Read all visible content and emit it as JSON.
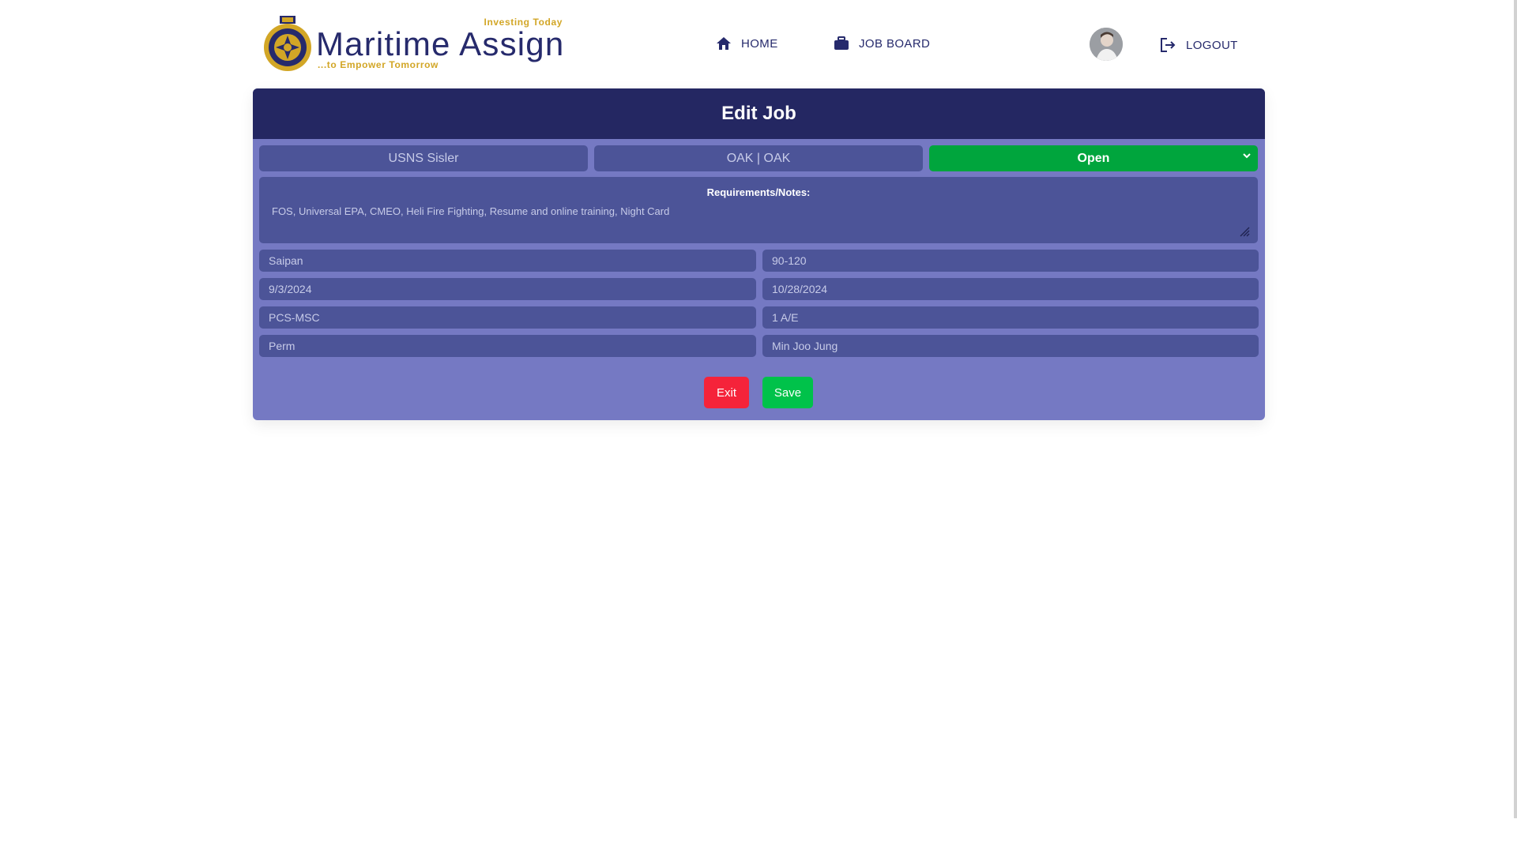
{
  "header": {
    "logo": {
      "tagline_top": "Investing Today",
      "title": "Maritime Assign",
      "tagline_bottom": "...to Empower Tomorrow"
    },
    "nav": {
      "home": "HOME",
      "job_board": "JOB BOARD",
      "logout": "LOGOUT"
    }
  },
  "card": {
    "title": "Edit Job",
    "ship": "USNS Sisler",
    "port": "OAK | OAK",
    "status": "Open",
    "notes_label": "Requirements/Notes:",
    "notes_text": "FOS, Universal EPA, CMEO, Heli Fire Fighting, Resume and online training, Night Card",
    "rows": {
      "r1_left": "Saipan",
      "r1_right": "90-120",
      "r2_left": "9/3/2024",
      "r2_right": "10/28/2024",
      "r3_left": "PCS-MSC",
      "r3_right": "1 A/E",
      "r4_left": "Perm",
      "r4_right": "Min Joo Jung"
    },
    "buttons": {
      "exit": "Exit",
      "save": "Save"
    }
  },
  "colors": {
    "navy": "#242762",
    "panel": "#7579c3",
    "field": "#4c5498",
    "status_green": "#00a53d",
    "exit_red": "#f5233a",
    "save_green": "#00c24a",
    "gold": "#d2a626"
  },
  "icons": {
    "home": "home-icon",
    "job_board": "briefcase-icon",
    "logout": "logout-icon",
    "status": "chevron-down-icon",
    "notes": "resize-handle-icon"
  }
}
